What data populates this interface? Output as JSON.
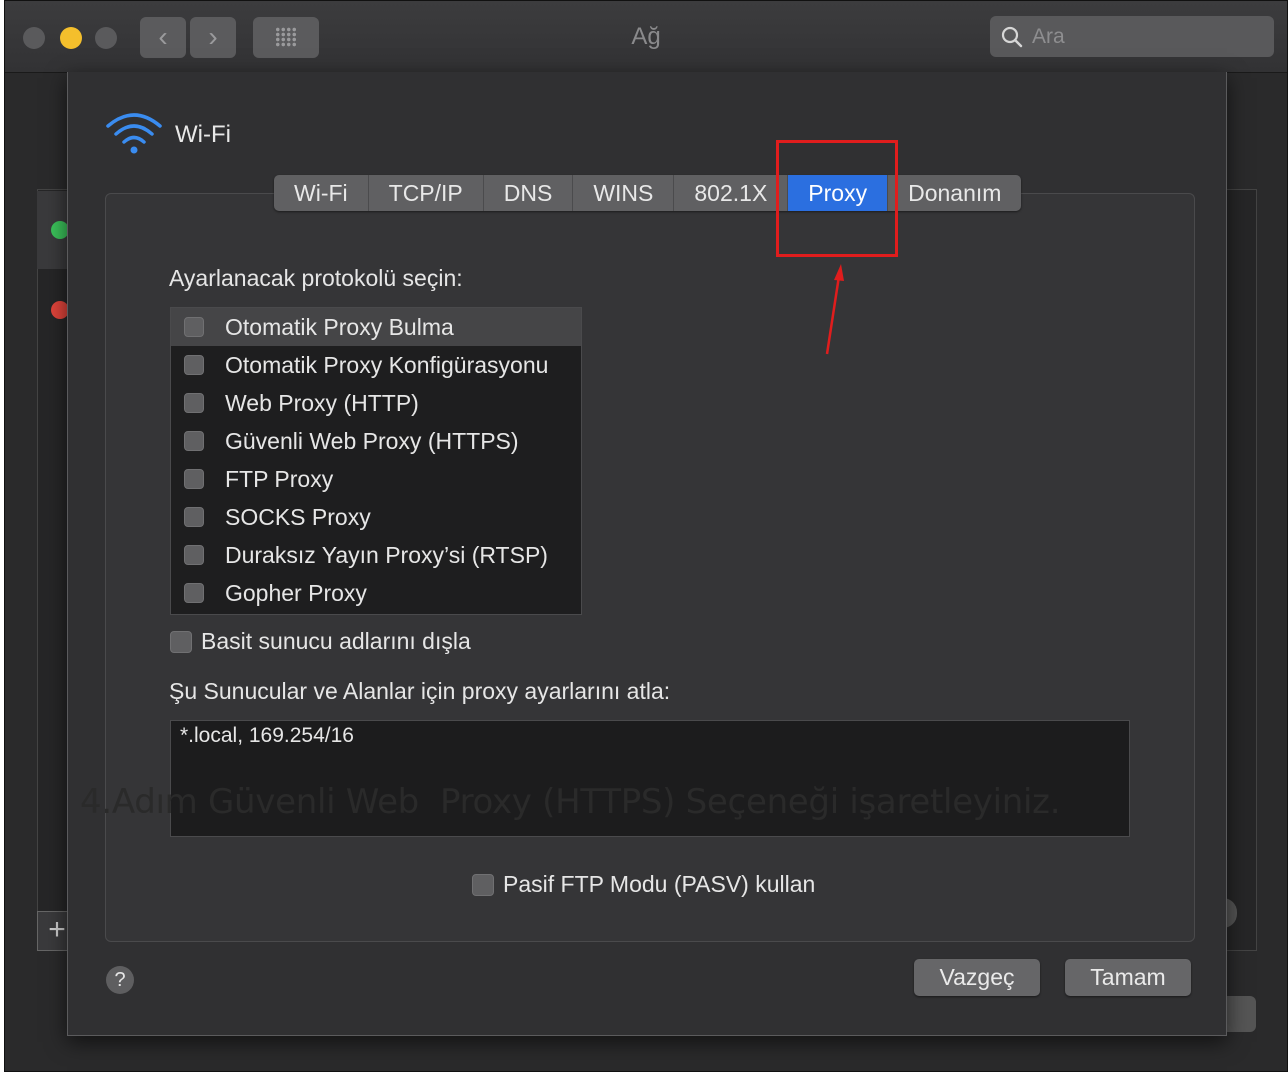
{
  "window": {
    "title": "Ağ"
  },
  "toolbar": {
    "back_icon": "‹",
    "forward_icon": "›"
  },
  "search": {
    "placeholder": "Ara",
    "value": ""
  },
  "sheet": {
    "interface_name": "Wi-Fi",
    "tabs": [
      {
        "label": "Wi-Fi"
      },
      {
        "label": "TCP/IP"
      },
      {
        "label": "DNS"
      },
      {
        "label": "WINS"
      },
      {
        "label": "802.1X"
      },
      {
        "label": "Proxy",
        "active": true
      },
      {
        "label": "Donanım"
      }
    ],
    "protocol_heading": "Ayarlanacak protokolü seçin:",
    "protocols": [
      {
        "label": "Otomatik Proxy Bulma",
        "checked": false,
        "selected": true
      },
      {
        "label": "Otomatik Proxy Konfigürasyonu",
        "checked": false
      },
      {
        "label": "Web Proxy (HTTP)",
        "checked": false
      },
      {
        "label": "Güvenli Web Proxy (HTTPS)",
        "checked": false
      },
      {
        "label": "FTP Proxy",
        "checked": false
      },
      {
        "label": "SOCKS Proxy",
        "checked": false
      },
      {
        "label": "Duraksız Yayın Proxy’si (RTSP)",
        "checked": false
      },
      {
        "label": "Gopher Proxy",
        "checked": false
      }
    ],
    "exclude_simple_label": "Basit sunucu adlarını dışla",
    "bypass_label": "Şu Sunucular ve Alanlar için proxy ayarlarını atla:",
    "bypass_value": "*.local, 169.254/16",
    "pasv_label": "Pasif FTP Modu (PASV) kullan",
    "help_label": "?",
    "cancel_label": "Vazgeç",
    "ok_label": "Tamam"
  },
  "annotation": {
    "caption": "4.Adım Güvenli Web  Proxy (HTTPS) Seçeneği işaretleyiniz.",
    "highlight_color": "#e01d1d"
  },
  "colors": {
    "accent": "#2b6fe0",
    "wifi": "#3a8cf0",
    "yellow_light": "#f4bf2c"
  }
}
